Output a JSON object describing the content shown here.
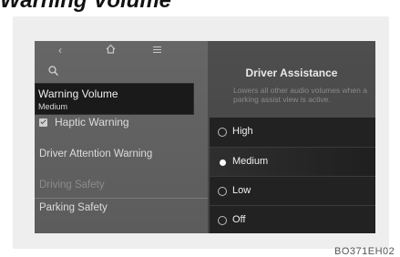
{
  "page": {
    "heading": "Warning Volume",
    "reference_code": "BO371EH02"
  },
  "nav": {
    "icons": [
      "back-icon",
      "home-icon",
      "menu-icon",
      "search-icon"
    ]
  },
  "right_panel": {
    "title": "Driver Assistance",
    "description": "Lowers all other audio volumes when a parking assist view is active."
  },
  "popup": {
    "title": "Warning Volume",
    "value": "Medium"
  },
  "menu": {
    "haptic_warning": "Haptic Warning",
    "driver_attention_warning": "Driver Attention Warning",
    "driving_safety": "Driving Safety",
    "parking_safety": "Parking Safety"
  },
  "options": [
    {
      "label": "High",
      "selected": false
    },
    {
      "label": "Medium",
      "selected": true
    },
    {
      "label": "Low",
      "selected": false
    },
    {
      "label": "Off",
      "selected": false
    }
  ]
}
